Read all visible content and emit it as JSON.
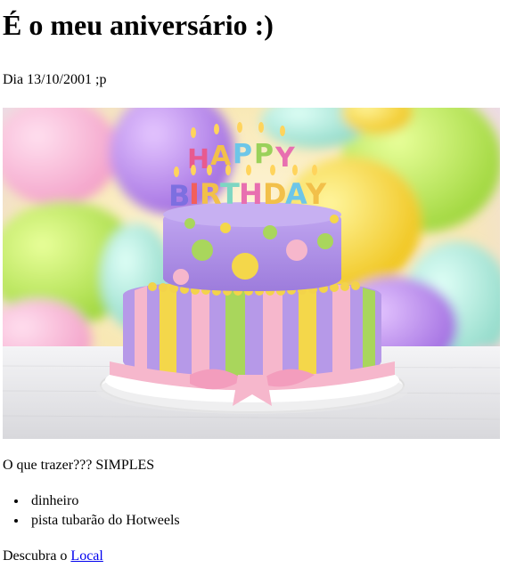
{
  "heading": "É o meu aniversário :)",
  "date_line": "Dia 13/10/2001 ;p",
  "image": {
    "description_icon": "birthday-cake-image",
    "topper_letters": [
      "H",
      "A",
      "P",
      "P",
      "Y",
      "B",
      "I",
      "R",
      "T",
      "H",
      "D",
      "A",
      "Y"
    ],
    "topper_colors": [
      "#e85a8f",
      "#f2c04a",
      "#6dc6e8",
      "#9ad15a",
      "#e86fb0",
      "#7d6fe0",
      "#f25f5c",
      "#f2c04a",
      "#7dd6c2",
      "#e86fb0",
      "#f2c04a",
      "#6dc6e8",
      "#f2c04a"
    ]
  },
  "bring_text": "O que trazer??? SIMPLES",
  "items": [
    "dinheiro",
    "pista tubarão do Hotweels"
  ],
  "place_prefix": "Descubra o",
  "place_link": "Local",
  "colors": {
    "link": "#0000ee",
    "cake_purple": "#a98be0",
    "cake_yellow": "#f4d74a",
    "cake_pink": "#f6b7cc",
    "cake_green": "#a9d65c"
  }
}
